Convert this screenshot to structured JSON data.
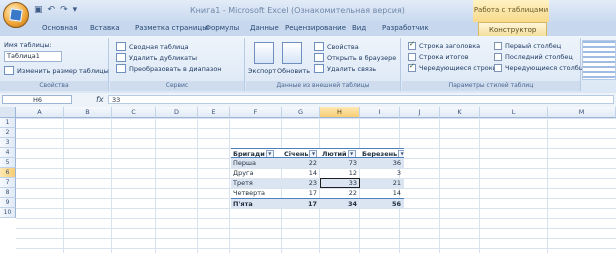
{
  "window": {
    "title": "Книга1 - Microsoft Excel (Ознакомительная версия)",
    "context_title": "Работа с таблицами"
  },
  "tabs": [
    "Основная",
    "Вставка",
    "Разметка страницы",
    "Формулы",
    "Данные",
    "Рецензирование",
    "Вид",
    "Разработчик",
    "Конструктор"
  ],
  "active_tab": "Конструктор",
  "ribbon": {
    "properties": {
      "name_label": "Имя таблицы:",
      "name_value": "Таблица1",
      "resize_label": "Изменить размер таблицы",
      "group_label": "Свойства"
    },
    "tools": {
      "summary_label": "Сводная таблица",
      "remove_dup_label": "Удалить дубликаты",
      "convert_label": "Преобразовать в диапазон",
      "group_label": "Сервис"
    },
    "external": {
      "export_label": "Экспорт",
      "refresh_label": "Обновить",
      "props_label": "Свойства",
      "open_browser_label": "Открыть в браузере",
      "unlink_label": "Удалить связь",
      "group_label": "Данные из внешней таблицы"
    },
    "options": {
      "header_row_label": "Строка заголовка",
      "header_row_checked": true,
      "total_row_label": "Строка итогов",
      "total_row_checked": false,
      "banded_rows_label": "Чередующиеся строки",
      "banded_rows_checked": true,
      "first_col_label": "Первый столбец",
      "first_col_checked": false,
      "last_col_label": "Последний столбец",
      "last_col_checked": false,
      "banded_cols_label": "Чередующиеся столбцы",
      "banded_cols_checked": false,
      "group_label": "Параметры стилей таблиц"
    }
  },
  "formula_bar": {
    "cell_ref": "H6",
    "fx_label": "fx",
    "value": "33"
  },
  "columns": [
    "A",
    "B",
    "C",
    "D",
    "E",
    "F",
    "G",
    "H",
    "I",
    "J",
    "K",
    "L",
    "M"
  ],
  "selected_column": "H",
  "rows": [
    "1",
    "2",
    "3",
    "4",
    "5",
    "6",
    "7",
    "8",
    "9",
    "10"
  ],
  "selected_row": "6",
  "table": {
    "headers": [
      "Бригади",
      "Січень",
      "Лютий",
      "Березень"
    ],
    "rows": [
      {
        "name": "Перша",
        "values": [
          "22",
          "73",
          "36"
        ]
      },
      {
        "name": "Друга",
        "values": [
          "14",
          "12",
          "3"
        ]
      },
      {
        "name": "Третя",
        "values": [
          "23",
          "33",
          "21"
        ]
      },
      {
        "name": "Четверта",
        "values": [
          "17",
          "22",
          "14"
        ]
      },
      {
        "name": "П'ята",
        "values": [
          "17",
          "34",
          "56"
        ]
      }
    ]
  }
}
